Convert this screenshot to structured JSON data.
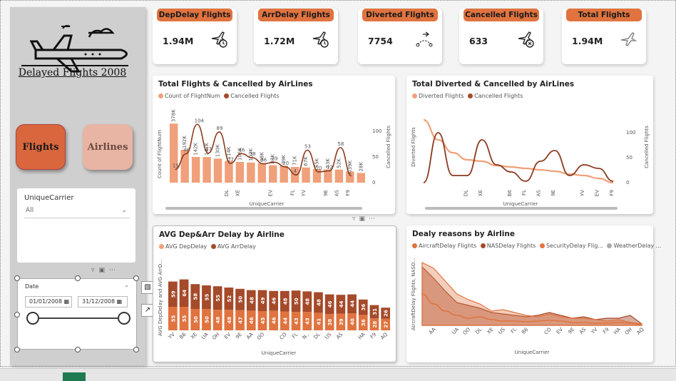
{
  "sidebar": {
    "title": "Delayed Flights 2008",
    "nav_flights": "Flights",
    "nav_airlines": "Airlines",
    "carrier_slicer": {
      "label": "UniqueCarrier",
      "value": "All"
    },
    "date_slicer": {
      "label": "Date",
      "start": "01/01/2008",
      "end": "31/12/2008"
    }
  },
  "kpis": [
    {
      "title": "DepDelay Flights",
      "value": "1.94M",
      "icon": "plane-clock-icon"
    },
    {
      "title": "ArrDelay Flights",
      "value": "1.72M",
      "icon": "plane-clock-icon"
    },
    {
      "title": "Diverted Flights",
      "value": "7754",
      "icon": "diverted-route-icon"
    },
    {
      "title": "Cancelled Flights",
      "value": "633",
      "icon": "plane-cancel-icon"
    },
    {
      "title": "Total Flights",
      "value": "1.94M",
      "icon": "plane-icon"
    }
  ],
  "colors": {
    "accent": "#e0733f",
    "light": "#f0a07a",
    "dark": "#a54a2a",
    "brown": "#8b3a1e"
  },
  "chart_data": [
    {
      "type": "bar",
      "title": "Total Flights & Cancelled by AirLines",
      "series": [
        {
          "name": "Count of FlightNum"
        },
        {
          "name": "Cancelled Flights"
        }
      ],
      "ylabel_left": "Count of FlightNum",
      "ylabel_right": "Cancelled Flights",
      "xlabel": "UniqueCarrier",
      "y_right_ticks": [
        "100",
        "50",
        "0"
      ],
      "bar_labels": [
        "378K",
        "192K",
        "142K",
        "141K",
        "130K",
        "114K",
        "106K",
        "102K",
        "98K",
        "83K",
        "79K",
        "71K",
        "67K",
        "55K",
        "53K",
        "52K",
        "39K",
        "28K"
      ],
      "values": [
        378,
        192,
        142,
        141,
        130,
        114,
        106,
        102,
        98,
        83,
        79,
        71,
        67,
        55,
        53,
        52,
        39,
        28
      ],
      "line_labels": [
        "15",
        "46",
        "104",
        "47",
        "89",
        "27",
        "46",
        "38",
        "26",
        "29",
        "20",
        "4",
        "53",
        "10",
        "12",
        "58",
        "2"
      ],
      "categories": [
        "",
        "",
        "",
        "",
        "",
        "DL",
        "XE",
        "",
        "",
        "EV",
        "",
        "FL",
        "YV",
        "",
        "9E",
        "AS",
        "F9",
        ""
      ]
    },
    {
      "type": "line",
      "title": "Total Diverted & Cancelled by AirLines",
      "series": [
        {
          "name": "Diverted Flights"
        },
        {
          "name": "Cancelled Flights"
        }
      ],
      "ylabel_left": "Diverted Flights",
      "ylabel_right": "Cancelled Flights",
      "xlabel": "UniqueCarrier",
      "y_right_ticks": [
        "100",
        "50",
        "0"
      ],
      "categories": [
        "",
        "",
        "",
        "DL",
        "XE",
        "",
        "B6",
        "FL",
        "AS",
        "9E",
        "",
        "YV",
        "EV",
        "F9"
      ]
    },
    {
      "type": "bar",
      "title": "AVG Dep&Arr Delay by Airline",
      "series": [
        {
          "name": "AVG DepDelay"
        },
        {
          "name": "AVG ArrDelay"
        }
      ],
      "ylabel": "AVG DepDelay and AVG ArrD...",
      "xlabel": "UniqueCarrier",
      "categories": [
        "YV",
        "B6",
        "XE",
        "UA",
        "OH",
        "EV",
        "9E",
        "AA",
        "OO",
        "",
        "CO",
        "FL",
        "N..",
        "DL",
        "US",
        "AS",
        "",
        "HA",
        "F9",
        "AQ"
      ],
      "dep": [
        55,
        55,
        50,
        50,
        48,
        48,
        47,
        46,
        45,
        46,
        44,
        43,
        43,
        41,
        38,
        39,
        40,
        36,
        28,
        27
      ],
      "arr": [
        59,
        64,
        58,
        55,
        55,
        52,
        50,
        48,
        49,
        46,
        48,
        50,
        48,
        48,
        46,
        44,
        44,
        36,
        31,
        26
      ]
    },
    {
      "type": "area",
      "title": "Dealy reasons by Airline",
      "series": [
        {
          "name": "AircraftDelay Flights"
        },
        {
          "name": "NASDelay Flights"
        },
        {
          "name": "SecurityDelay Flig..."
        },
        {
          "name": "WeatherDelay ..."
        }
      ],
      "ylabel": "AircraftDelay Flights, NASD...",
      "xlabel": "UniqueCarrier",
      "categories": [
        "",
        "AA",
        "",
        "UA",
        "OO",
        "DL",
        "XE",
        "US",
        "FL",
        "B6",
        "",
        "CO",
        "EV",
        "9E",
        "AS",
        "YV",
        "F9",
        "HA",
        "OH",
        "AQ"
      ]
    }
  ]
}
